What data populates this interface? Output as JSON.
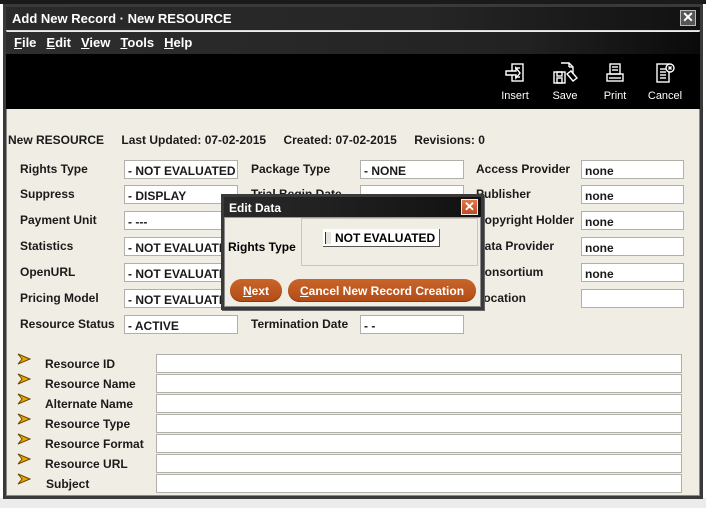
{
  "window": {
    "title": "Add New Record · New RESOURCE",
    "close_label": "✕"
  },
  "menu": [
    {
      "label": "File",
      "accel": "F",
      "rest": "ile"
    },
    {
      "label": "Edit",
      "accel": "E",
      "rest": "dit"
    },
    {
      "label": "View",
      "accel": "V",
      "rest": "iew"
    },
    {
      "label": "Tools",
      "accel": "T",
      "rest": "ools"
    },
    {
      "label": "Help",
      "accel": "H",
      "rest": "elp"
    }
  ],
  "toolbar": {
    "insert": {
      "label": "Insert",
      "icon": "insert-icon"
    },
    "save": {
      "label": "Save",
      "icon": "save-icon"
    },
    "print": {
      "label": "Print",
      "icon": "print-icon"
    },
    "cancel": {
      "label": "Cancel",
      "icon": "cancel-icon"
    }
  },
  "record_info": {
    "record_type": "New RESOURCE",
    "last_updated": "Last Updated: 07-02-2015",
    "created": "Created: 07-02-2015",
    "revisions": "Revisions: 0"
  },
  "left_fields": [
    {
      "label": "Rights Type",
      "value": "-  NOT EVALUATED"
    },
    {
      "label": "Suppress",
      "value": "-  DISPLAY"
    },
    {
      "label": "Payment Unit",
      "value": "-  ---"
    },
    {
      "label": "Statistics",
      "value": "-  NOT EVALUATED"
    },
    {
      "label": "OpenURL",
      "value": "-  NOT EVALUATED"
    },
    {
      "label": "Pricing Model",
      "value": "-  NOT EVALUATED"
    },
    {
      "label": "Resource Status",
      "value": "-  ACTIVE"
    }
  ],
  "middle_fields": [
    {
      "label": "Package Type",
      "value": "-  NONE"
    },
    {
      "label": "Trial Begin Date",
      "value": ""
    },
    {
      "label": "Termination Date",
      "value": "-  -"
    }
  ],
  "right_fields": [
    {
      "label": "Access Provider",
      "value": "none"
    },
    {
      "label": "Publisher",
      "value": "none"
    },
    {
      "label": "Copyright Holder",
      "value": "none"
    },
    {
      "label": "Data Provider",
      "value": "none"
    },
    {
      "label": "Consortium",
      "value": "none"
    },
    {
      "label": "Location",
      "value": ""
    }
  ],
  "text_fields": [
    {
      "label": "Resource ID",
      "value": ""
    },
    {
      "label": "Resource Name",
      "value": ""
    },
    {
      "label": "Alternate Name",
      "value": ""
    },
    {
      "label": "Resource Type",
      "value": ""
    },
    {
      "label": "Resource Format",
      "value": ""
    },
    {
      "label": "Resource URL",
      "value": ""
    },
    {
      "label": "Subject",
      "value": ""
    }
  ],
  "dialog": {
    "title": "Edit Data",
    "close_label": "✕",
    "field_label": "Rights Type",
    "field_value": "NOT EVALUATED",
    "next_accel": "N",
    "next_rest": "ext",
    "cancel_accel": "C",
    "cancel_rest": "ancel New Record Creation"
  },
  "colors": {
    "accent_orange": "#b9561c",
    "panel_bg": "#f0ede4",
    "titlebar_bg": "#262626",
    "arrow_icon": "#e8a400"
  }
}
